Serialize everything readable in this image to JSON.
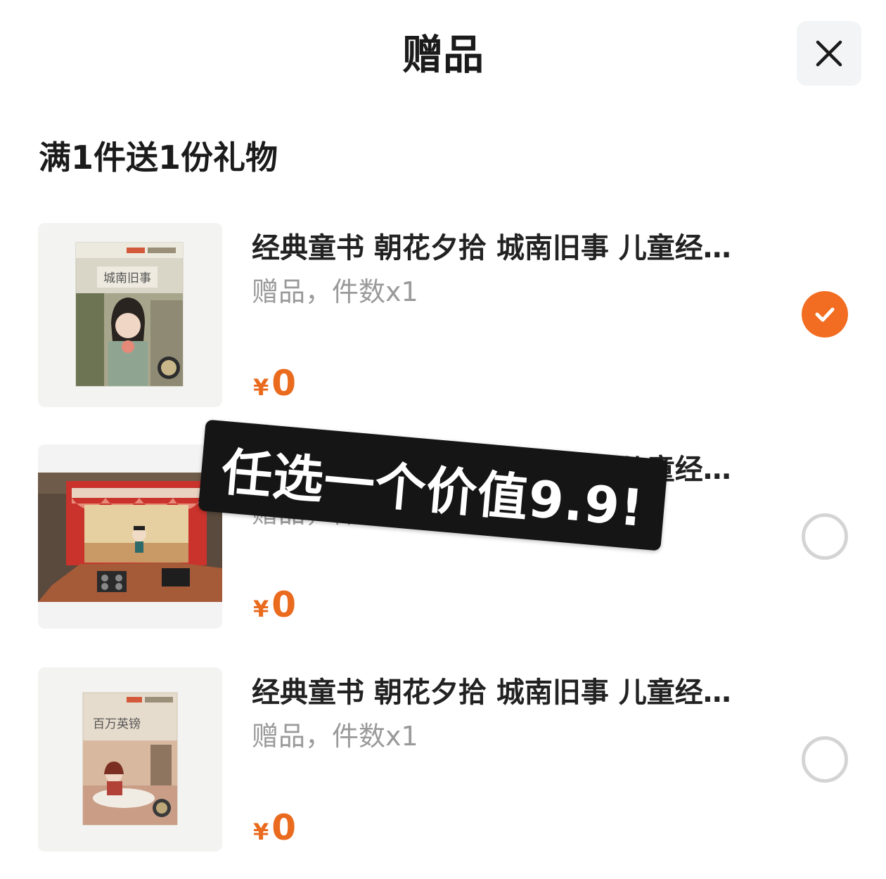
{
  "header": {
    "title": "赠品",
    "close_icon": "close-icon"
  },
  "section": {
    "title": "满1件送1份礼物"
  },
  "items": [
    {
      "title": "经典童书 朝花夕拾 城南旧事 儿童经…",
      "subtitle": "赠品，件数x1",
      "currency": "¥",
      "price": "0",
      "cover_text": "城南旧事",
      "selected": true
    },
    {
      "title": "经典童书 朝花夕拾 城南旧事 儿童经…",
      "subtitle": "赠品，件数x1",
      "currency": "¥",
      "price": "0",
      "selected": false
    },
    {
      "title": "经典童书 朝花夕拾 城南旧事 儿童经…",
      "subtitle": "赠品，件数x1",
      "currency": "¥",
      "price": "0",
      "cover_text": "百万英镑",
      "selected": false
    }
  ],
  "overlay": {
    "banner_text": "任选一个价值9.9!"
  },
  "colors": {
    "accent": "#f26d21",
    "price": "#ea6a1e",
    "banner_bg": "#151515"
  }
}
